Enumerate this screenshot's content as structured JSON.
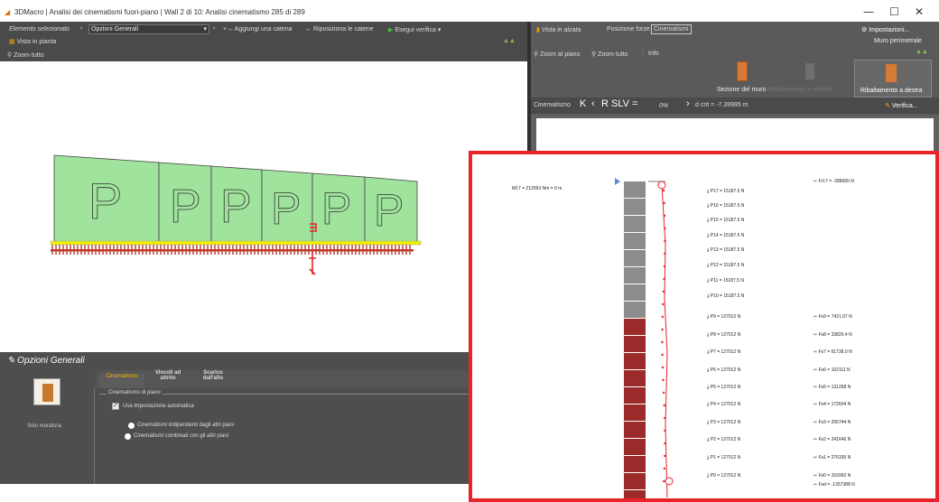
{
  "window": {
    "title": "3DMacro | Analisi dei cinematismi fuori-piano | Wall 2 di 10: Analisi cinematismo 285 di 289",
    "minimize": "—",
    "maximize": "☐",
    "close": "✕"
  },
  "left_toolbar": {
    "selected_label": "Elemento selezionato",
    "combo_value": "Opzioni Generali",
    "add_chain": "Aggiungi una catena",
    "reposition_chains": "Riposiziona le catene",
    "run_check": "Esegui verifica",
    "plan_view": "Vista in pianta",
    "zoom_all": "Zoom tutto"
  },
  "right_toolbar": {
    "tab_elevation": "Vista in alzata",
    "tab_forces": "Posizione forze",
    "tab_kinematics": "Cinematismi",
    "settings": "Impostazioni...",
    "perimeter_wall": "Muro perimetrale",
    "zoom_plan": "Zoom al piano",
    "zoom_all": "Zoom tutto",
    "info": "Info",
    "wall_section": "Sezione del muro",
    "wall_overturn_dim": "Ribaltamento a sinistra",
    "overturn_right": "Ribaltamento a destra",
    "kinematism_label": "Cinematismo",
    "k_label": "K",
    "r_slv": "R SLV =",
    "r_value": "0%",
    "d_crit": "d crit = -7.39995 m",
    "verify": "Verifica..."
  },
  "options_panel": {
    "title": "Opzioni Generali",
    "tabs": [
      "Cinematismo",
      "Vincoli ad attrito",
      "Scarico dall'alto"
    ],
    "card_label": "Solo muratura",
    "group_title": "Cinematismo di piano",
    "checkbox_auto": "Usa impostazione automatica",
    "radio_independent": "Cinematismi indipendenti dagli altri piani",
    "radio_combined": "Cinematismi combinati con gli altri piani"
  },
  "zoom_diagram": {
    "top_left_label": "M17 = 212093 Nm = 0 m",
    "loads_left": [
      "P17 = 15187.5 N",
      "P16 = 15187.5 N",
      "P15 = 15187.5 N",
      "P14 = 15187.5 N",
      "P13 = 15187.5 N",
      "P12 = 15187.5 N",
      "P11 = 15187.5 N",
      "P10 = 15187.5 N",
      "P9 = 127012 N",
      "P8 = 127012 N",
      "P7 = 127012 N",
      "P6 = 127012 N",
      "P5 = 127012 N",
      "P4 = 127012 N",
      "P3 = 127012 N",
      "P2 = 127012 N",
      "P1 = 127012 N",
      "P0 = 127012 N"
    ],
    "loads_right": [
      "Fr17 = -288665 N",
      "Fs9 = 7421.07 N",
      "Fs8 = 33820.4 N",
      "Fs7 = 61736.0 N",
      "Fs6 = 102111 N",
      "Fs5 = 131268 N",
      "Fs4 = 172604 N",
      "Fs3 = 206744 N",
      "Fs2 = 241646 N",
      "Fs1 = 276335 N",
      "Fs0 = 316992 N",
      "Fsd = -1357388 N"
    ]
  },
  "colors": {
    "accent": "#e8232a",
    "panel_green": "#9fe39c",
    "support_yellow": "#f2ee00",
    "ground_red": "#c0392b",
    "brick_dark": "#9b2a2a",
    "brick_grey": "#8c8c8c"
  }
}
